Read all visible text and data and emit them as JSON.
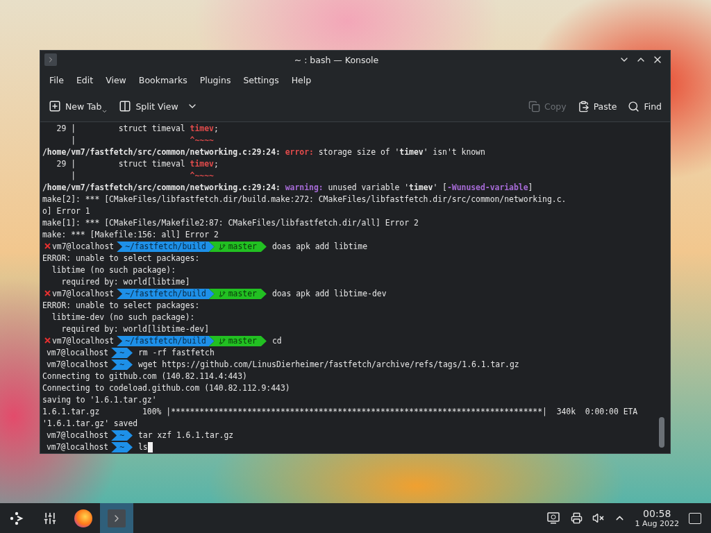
{
  "window": {
    "title": "~ : bash — Konsole"
  },
  "menu": [
    "File",
    "Edit",
    "View",
    "Bookmarks",
    "Plugins",
    "Settings",
    "Help"
  ],
  "toolbar": {
    "left": [
      {
        "kind": "new-tab",
        "label": "New Tab",
        "disabled": false
      },
      {
        "kind": "split-view",
        "label": "Split View",
        "disabled": false
      }
    ],
    "right": [
      {
        "kind": "copy",
        "label": "Copy",
        "disabled": true
      },
      {
        "kind": "paste",
        "label": "Paste",
        "disabled": false
      },
      {
        "kind": "find",
        "label": "Find",
        "disabled": false
      }
    ]
  },
  "terminal": {
    "lines": [
      {
        "kind": "output",
        "segments": [
          {
            "text": "   29 |         struct timeval ",
            "kind": "plain"
          },
          {
            "text": "timev",
            "kind": "red"
          },
          {
            "text": ";",
            "kind": "plain"
          }
        ]
      },
      {
        "kind": "output",
        "segments": [
          {
            "text": "      |                        ",
            "kind": "plain"
          },
          {
            "text": "^~~~~",
            "kind": "red"
          }
        ]
      },
      {
        "kind": "output",
        "segments": [
          {
            "text": "/home/vm7/fastfetch/src/common/networking.c:29:24: ",
            "kind": "bold"
          },
          {
            "text": "error:",
            "kind": "red"
          },
          {
            "text": " storage size of '",
            "kind": "plain"
          },
          {
            "text": "timev",
            "kind": "bold"
          },
          {
            "text": "' isn't known",
            "kind": "plain"
          }
        ]
      },
      {
        "kind": "output",
        "segments": [
          {
            "text": "   29 |         struct timeval ",
            "kind": "plain"
          },
          {
            "text": "timev",
            "kind": "red"
          },
          {
            "text": ";",
            "kind": "plain"
          }
        ]
      },
      {
        "kind": "output",
        "segments": [
          {
            "text": "      |                        ",
            "kind": "plain"
          },
          {
            "text": "^~~~~",
            "kind": "red"
          }
        ]
      },
      {
        "kind": "output",
        "segments": [
          {
            "text": "/home/vm7/fastfetch/src/common/networking.c:29:24: ",
            "kind": "bold"
          },
          {
            "text": "warning:",
            "kind": "purple"
          },
          {
            "text": " unused variable '",
            "kind": "plain"
          },
          {
            "text": "timev",
            "kind": "bold"
          },
          {
            "text": "' [",
            "kind": "plain"
          },
          {
            "text": "-Wunused-variable",
            "kind": "purple"
          },
          {
            "text": "]",
            "kind": "plain"
          }
        ]
      },
      {
        "kind": "output",
        "segments": [
          {
            "text": "make[2]: *** [CMakeFiles/libfastfetch.dir/build.make:272: CMakeFiles/libfastfetch.dir/src/common/networking.c.",
            "kind": "plain"
          }
        ]
      },
      {
        "kind": "output",
        "segments": [
          {
            "text": "o] Error 1",
            "kind": "plain"
          }
        ]
      },
      {
        "kind": "output",
        "segments": [
          {
            "text": "make[1]: *** [CMakeFiles/Makefile2:87: CMakeFiles/libfastfetch.dir/all] Error 2",
            "kind": "plain"
          }
        ]
      },
      {
        "kind": "output",
        "segments": [
          {
            "text": "make: *** [Makefile:156: all] Error 2",
            "kind": "plain"
          }
        ]
      },
      {
        "kind": "prompt",
        "failed": true,
        "user": "vm7@localhost",
        "path": "~/fastfetch/build",
        "branch": "master",
        "command": "doas apk add libtime",
        "cursor": false
      },
      {
        "kind": "output",
        "segments": [
          {
            "text": "ERROR: unable to select packages:",
            "kind": "plain"
          }
        ]
      },
      {
        "kind": "output",
        "segments": [
          {
            "text": "  libtime (no such package):",
            "kind": "plain"
          }
        ]
      },
      {
        "kind": "output",
        "segments": [
          {
            "text": "    required by: world[libtime]",
            "kind": "plain"
          }
        ]
      },
      {
        "kind": "prompt",
        "failed": true,
        "user": "vm7@localhost",
        "path": "~/fastfetch/build",
        "branch": "master",
        "command": "doas apk add libtime-dev",
        "cursor": false
      },
      {
        "kind": "output",
        "segments": [
          {
            "text": "ERROR: unable to select packages:",
            "kind": "plain"
          }
        ]
      },
      {
        "kind": "output",
        "segments": [
          {
            "text": "  libtime-dev (no such package):",
            "kind": "plain"
          }
        ]
      },
      {
        "kind": "output",
        "segments": [
          {
            "text": "    required by: world[libtime-dev]",
            "kind": "plain"
          }
        ]
      },
      {
        "kind": "prompt",
        "failed": true,
        "user": "vm7@localhost",
        "path": "~/fastfetch/build",
        "branch": "master",
        "command": "cd",
        "cursor": false
      },
      {
        "kind": "prompt",
        "failed": false,
        "user": "vm7@localhost",
        "path": "~",
        "command": "rm -rf fastfetch",
        "cursor": false
      },
      {
        "kind": "prompt",
        "failed": false,
        "user": "vm7@localhost",
        "path": "~",
        "command": "wget https://github.com/LinusDierheimer/fastfetch/archive/refs/tags/1.6.1.tar.gz",
        "cursor": false
      },
      {
        "kind": "output",
        "segments": [
          {
            "text": "Connecting to github.com (140.82.114.4:443)",
            "kind": "plain"
          }
        ]
      },
      {
        "kind": "output",
        "segments": [
          {
            "text": "Connecting to codeload.github.com (140.82.112.9:443)",
            "kind": "plain"
          }
        ]
      },
      {
        "kind": "output",
        "segments": [
          {
            "text": "saving to '1.6.1.tar.gz'",
            "kind": "plain"
          }
        ]
      },
      {
        "kind": "output",
        "segments": [
          {
            "text": "1.6.1.tar.gz         100% |******************************************************************************|  340k  0:00:00 ETA",
            "kind": "plain"
          }
        ]
      },
      {
        "kind": "output",
        "segments": [
          {
            "text": "'1.6.1.tar.gz' saved",
            "kind": "plain"
          }
        ]
      },
      {
        "kind": "prompt",
        "failed": false,
        "user": "vm7@localhost",
        "path": "~",
        "command": "tar xzf 1.6.1.tar.gz",
        "cursor": false
      },
      {
        "kind": "prompt",
        "failed": false,
        "user": "vm7@localhost",
        "path": "~",
        "command": "ls",
        "cursor": true
      }
    ]
  },
  "taskbar": {
    "apps": [
      {
        "kind": "launcher",
        "selected": false
      },
      {
        "kind": "settings",
        "selected": false
      },
      {
        "kind": "browser",
        "selected": false
      },
      {
        "kind": "terminal",
        "selected": true
      }
    ],
    "clock": {
      "time": "00:58",
      "date": "1 Aug 2022"
    }
  }
}
